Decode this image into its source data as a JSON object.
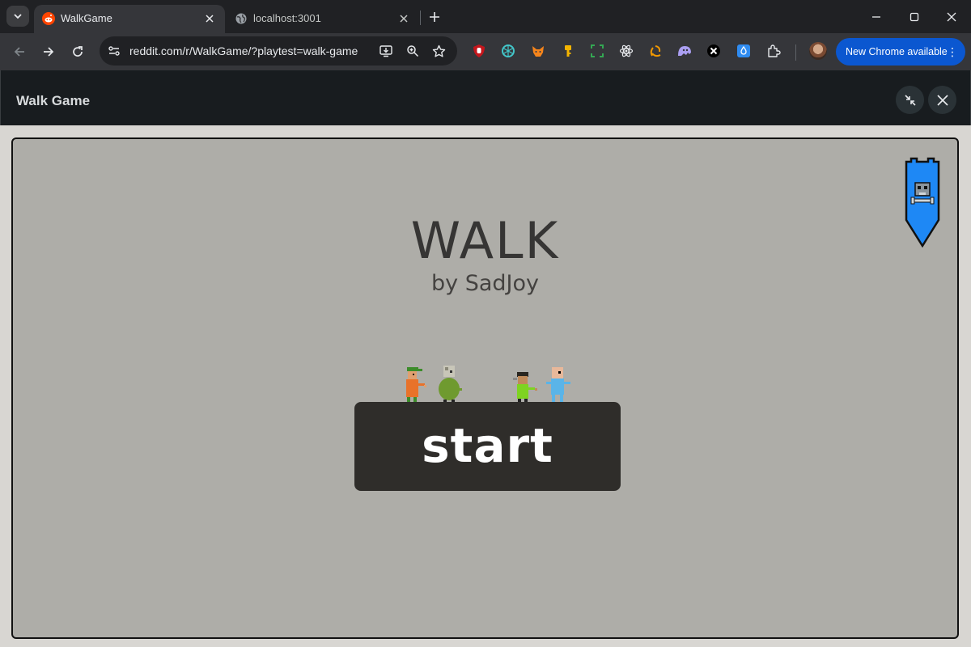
{
  "browser": {
    "tabs": [
      {
        "title": "WalkGame",
        "active": true,
        "favicon": "reddit-icon"
      },
      {
        "title": "localhost:3001",
        "active": false,
        "favicon": "globe-icon"
      }
    ],
    "address": "reddit.com/r/WalkGame/?playtest=walk-game",
    "update_button": "New Chrome available",
    "extensions": [
      "ublock-icon",
      "openai-icon",
      "metamask-icon",
      "key-icon",
      "screenshot-icon",
      "react-devtools-icon",
      "redux-icon",
      "ghost-icon",
      "x-icon",
      "shield-icon",
      "extensions-puzzle-icon"
    ]
  },
  "game_header": {
    "title": "Walk Game"
  },
  "game": {
    "title": "WALK",
    "subtitle": "by SadJoy",
    "start_label": "start"
  },
  "colors": {
    "canvas_bg": "#aeada8",
    "button_bg": "#2f2d2a",
    "banner_blue": "#1e88f5",
    "reddit_orange": "#ff4500"
  }
}
